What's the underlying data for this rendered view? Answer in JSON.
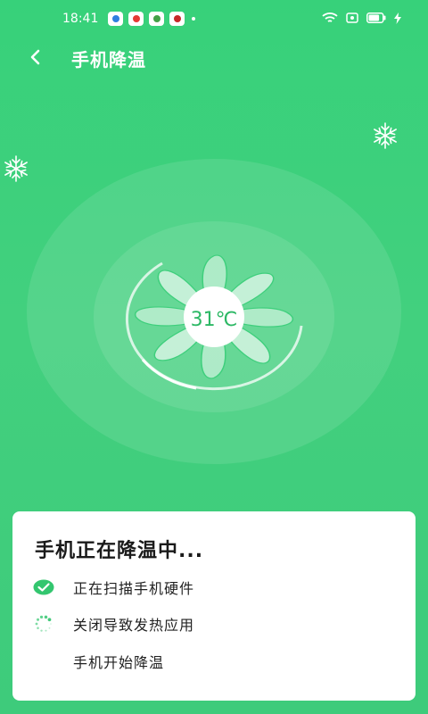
{
  "status_bar": {
    "time": "18:41",
    "battery_level": 0.8
  },
  "header": {
    "title": "手机降温"
  },
  "fan": {
    "temperature": "31℃"
  },
  "card": {
    "title": "手机正在降温中...",
    "steps": [
      {
        "label": "正在扫描手机硬件",
        "state": "done"
      },
      {
        "label": "关闭导致发热应用",
        "state": "loading"
      },
      {
        "label": "手机开始降温",
        "state": "pending"
      }
    ]
  },
  "colors": {
    "accent": "#2db865",
    "background": "#3ecf7c"
  }
}
